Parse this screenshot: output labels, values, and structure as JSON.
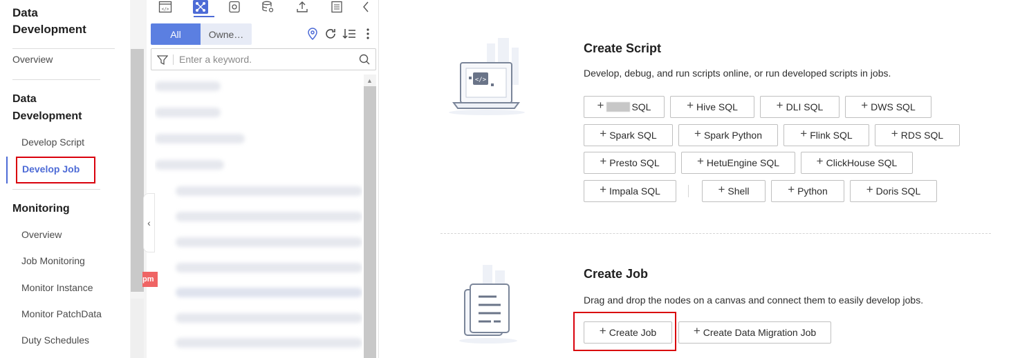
{
  "nav": {
    "title": "Data Development",
    "items_top": [
      "Overview"
    ],
    "section_dev": "Data Development",
    "dev_items": [
      "Develop Script",
      "Develop Job"
    ],
    "section_monitoring": "Monitoring",
    "monitoring_items": [
      "Overview",
      "Job Monitoring",
      "Monitor Instance",
      "Monitor PatchData",
      "Duty Schedules"
    ],
    "active_item": "Develop Job"
  },
  "tree": {
    "toolbar_icons": [
      "script-icon",
      "job-icon",
      "resource-icon",
      "database-icon",
      "upload-icon",
      "document-icon",
      "collapse-left-icon"
    ],
    "tabs": {
      "all": "All",
      "owner": "Owne…"
    },
    "search_placeholder": "Enter a keyword.",
    "red_chip_text": "pm"
  },
  "main": {
    "script": {
      "title": "Create Script",
      "description": "Develop, debug, and run scripts online, or run developed scripts in jobs.",
      "buttons_row1": [
        "SQL",
        "Hive SQL",
        "DLI SQL",
        "DWS SQL"
      ],
      "buttons_row2": [
        "Spark SQL",
        "Spark Python",
        "Flink SQL",
        "RDS SQL"
      ],
      "buttons_row3": [
        "Presto SQL",
        "HetuEngine SQL",
        "ClickHouse SQL"
      ],
      "buttons_row4": [
        "Impala SQL",
        "Shell",
        "Python",
        "Doris SQL"
      ]
    },
    "job": {
      "title": "Create Job",
      "description": "Drag and drop the nodes on a canvas and connect them to easily develop jobs.",
      "buttons": [
        "Create Job",
        "Create Data Migration Job"
      ]
    },
    "accent_color": "#4d6bd6",
    "highlight_color": "#d9000b"
  }
}
